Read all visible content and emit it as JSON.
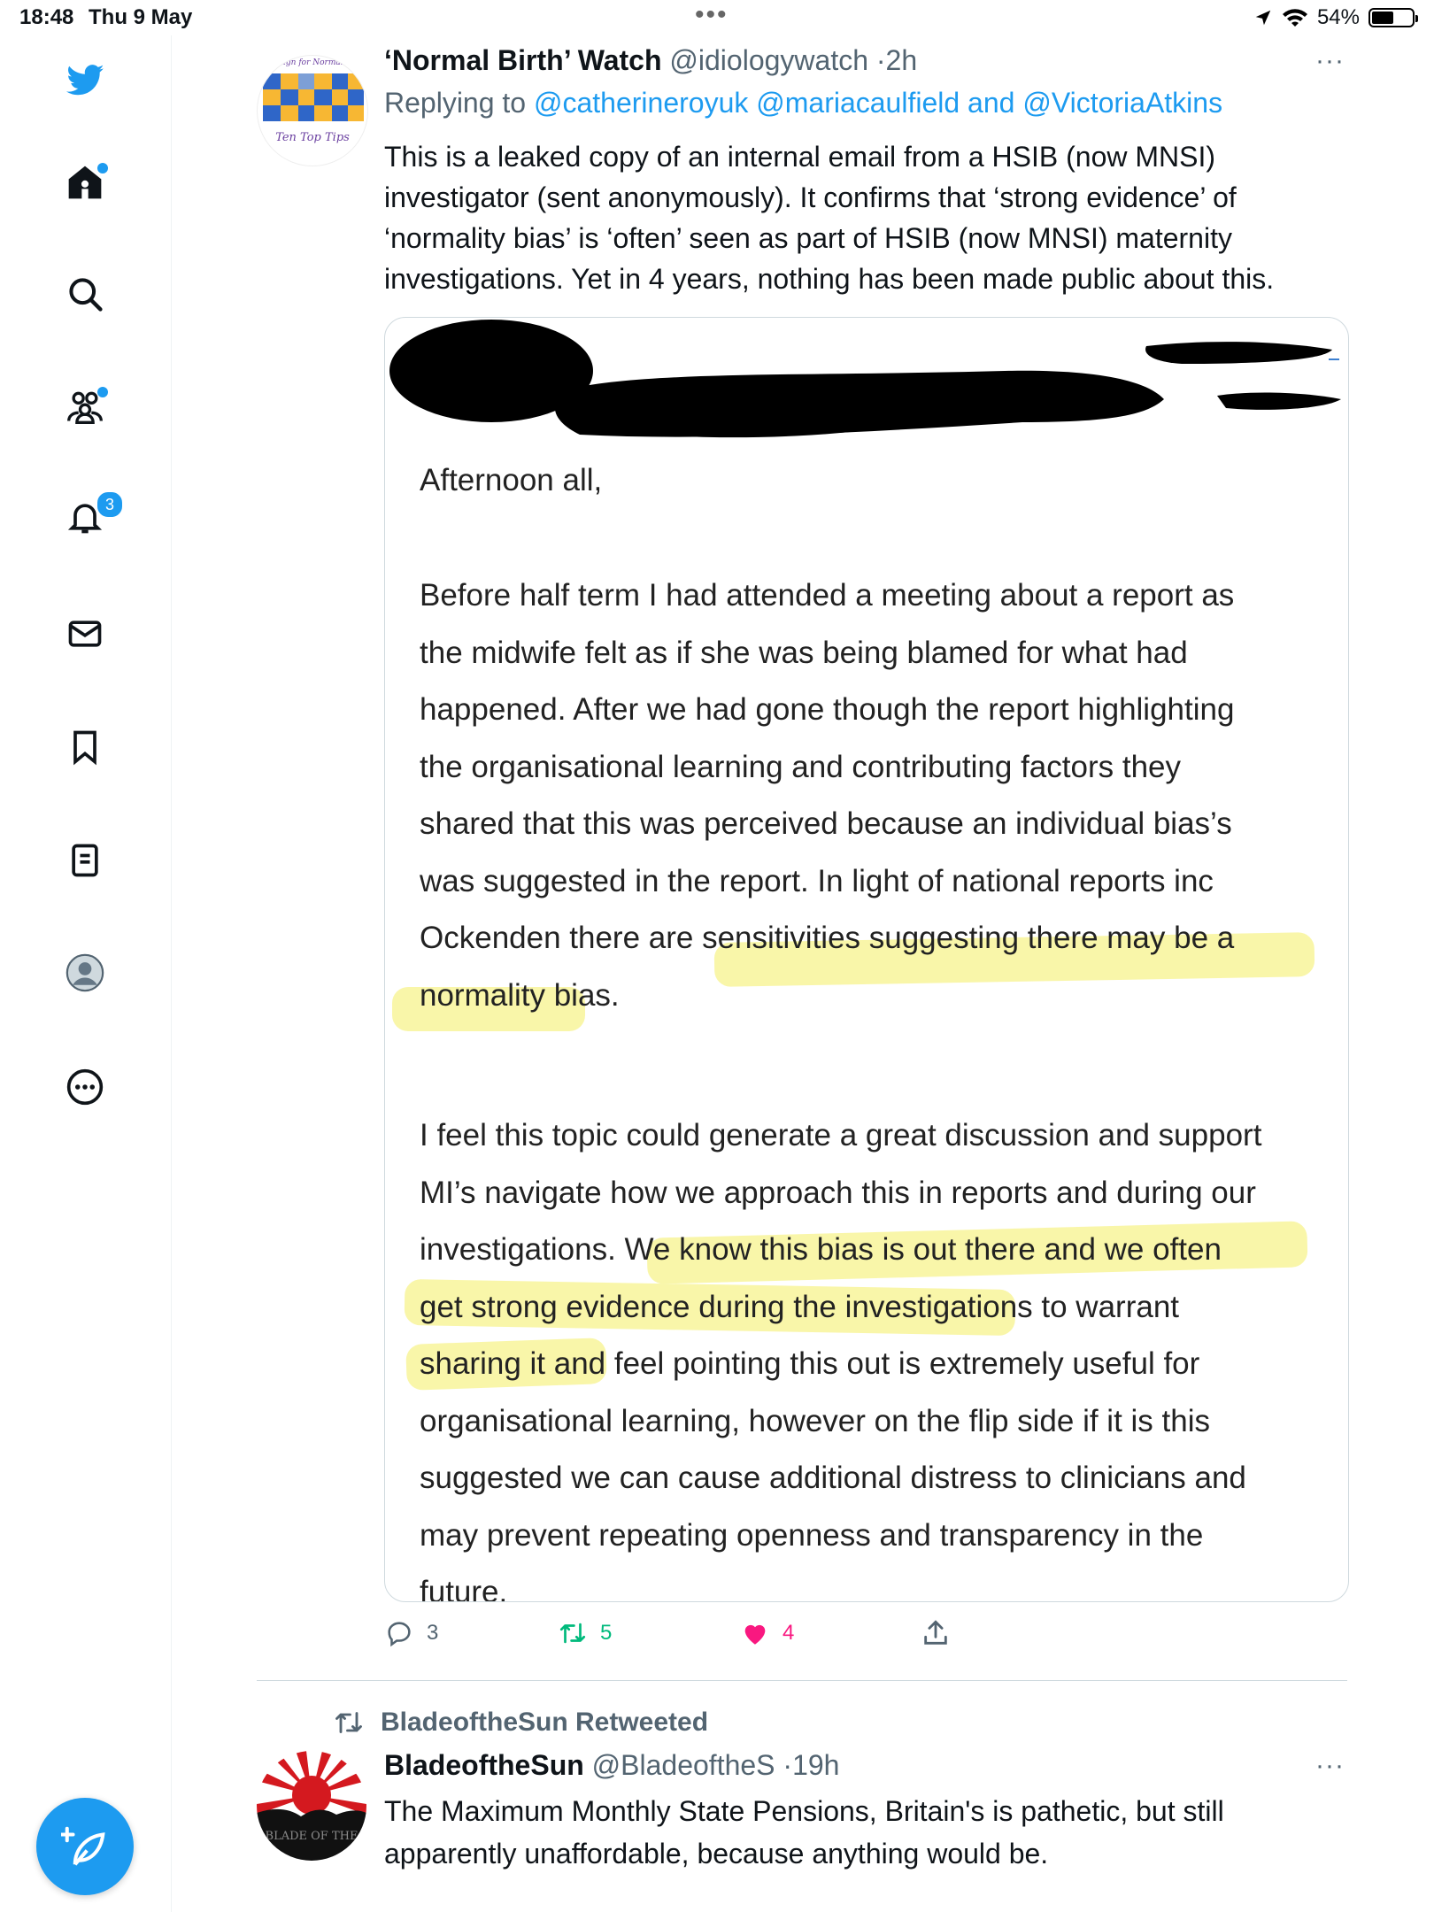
{
  "status_bar": {
    "time": "18:48",
    "date": "Thu 9 May",
    "battery": "54%"
  },
  "sidebar": {
    "notifications_count": "3"
  },
  "tweet1": {
    "avatar": {
      "top_text": "paign for Normal B",
      "bottom_text": "Ten Top Tips"
    },
    "name": "‘Normal Birth’ Watch",
    "handle": "@idiologywatch",
    "separator": "·",
    "time": "2h",
    "more": "···",
    "replying_label": "Replying to",
    "replying_1": "@catherineroyuk",
    "replying_2": "@mariacaulfield",
    "replying_and": "and",
    "replying_3": "@VictoriaAtkins",
    "text_lines": [
      "This is a leaked copy of an internal email from a HSIB (now MNSI)",
      "investigator (sent anonymously). It confirms that ‘strong evidence’ of",
      "‘normality bias’ is ‘often’ seen as part of HSIB (now MNSI) maternity",
      "investigations. Yet in 4 years, nothing has been made public about this."
    ],
    "email": {
      "greeting": "Afternoon all,",
      "para1": [
        "Before half term I had attended a meeting about a report as",
        "the midwife felt as if she was being blamed for what had",
        "happened. After we had gone though the report highlighting",
        "the organisational learning and contributing factors they",
        "shared that this was perceived because an individual bias’s",
        "was suggested in the report. In light of national reports inc",
        "Ockenden there are sensitivities suggesting there may be a",
        "normality bias."
      ],
      "para2": [
        "I feel this topic could generate a great discussion and support",
        "MI’s navigate how we approach this in reports and during our",
        "investigations. We know this bias is out there and we often",
        "get strong evidence during the investigations to warrant",
        "sharing it and feel pointing this out is extremely useful for",
        "organisational learning,  however on the flip side if it is this",
        "suggested we can cause additional distress to clinicians and",
        "may prevent repeating openness and transparency in the",
        "future."
      ]
    },
    "counts": {
      "replies": "3",
      "retweets": "5",
      "likes": "4"
    },
    "colors": {
      "retweet": "#00ba7c",
      "like": "#f91880",
      "highlight": "#f8f59a"
    }
  },
  "tweet2": {
    "retweeted_by": "BladeoftheSun Retweeted",
    "avatar_text": "BLADE OF THE",
    "name": "BladeoftheSun",
    "handle": "@BladeoftheS",
    "separator": "·",
    "time": "19h",
    "more": "···",
    "text_lines": [
      "The Maximum Monthly State Pensions, Britain's is pathetic, but still",
      "apparently unaffordable, because anything would be."
    ]
  },
  "theme": {
    "accent": "#1d9bf0",
    "text": "#0f1419",
    "muted": "#536471"
  }
}
